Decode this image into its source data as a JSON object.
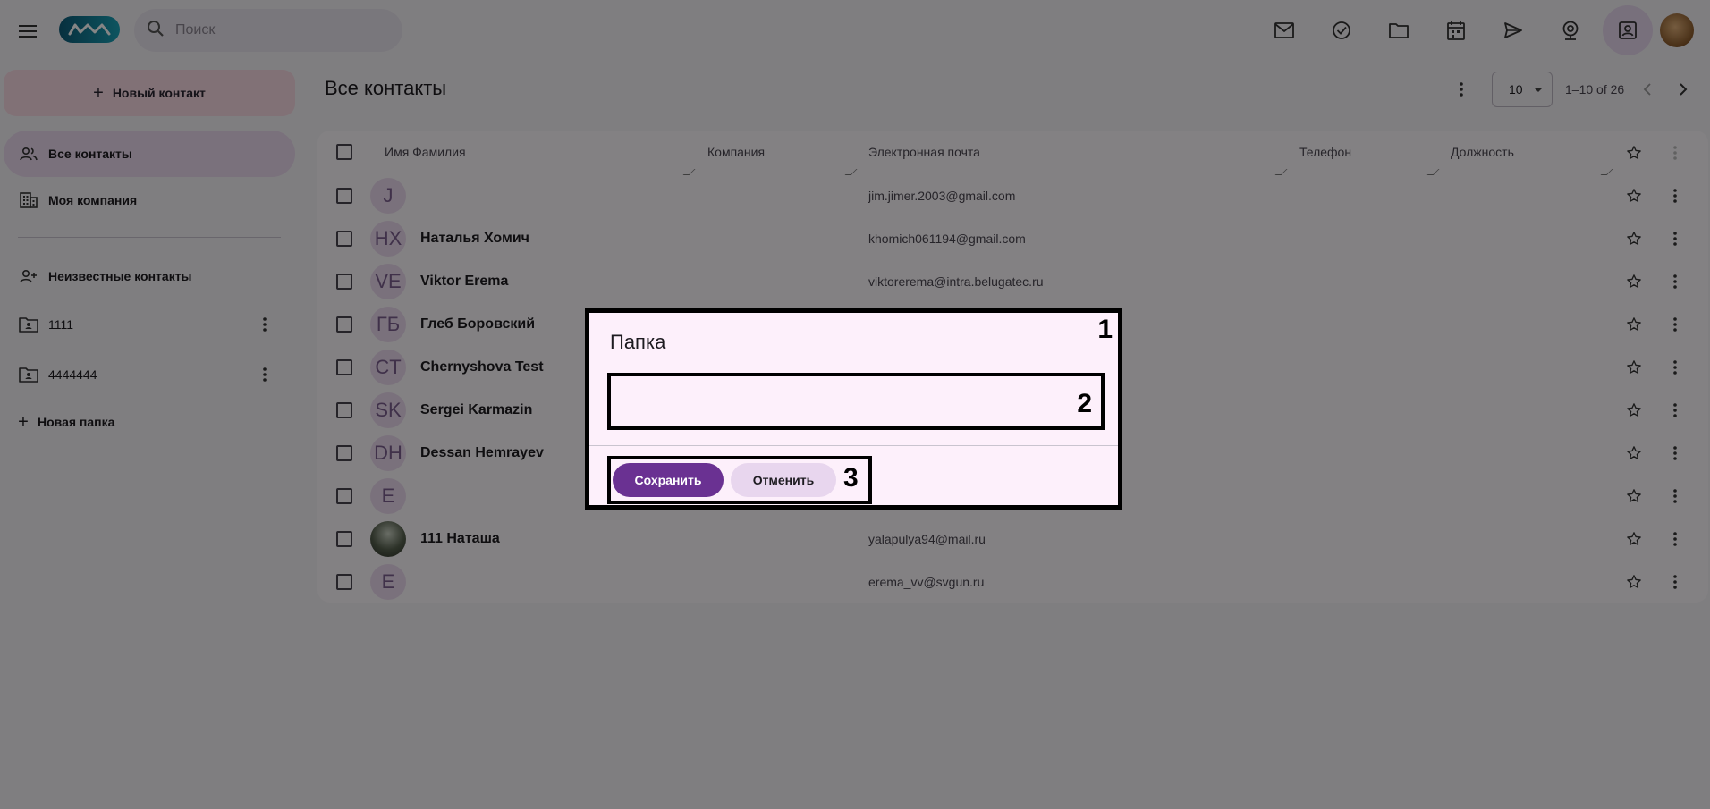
{
  "header": {
    "search_placeholder": "Поиск",
    "top_icons": [
      "mail-icon",
      "task-check-icon",
      "folder-icon",
      "calendar-icon",
      "send-icon",
      "webcam-icon",
      "contacts-icon"
    ],
    "active_icon": "contacts-icon"
  },
  "sidebar": {
    "new_contact_label": "Новый контакт",
    "items": [
      {
        "label": "Все контакты",
        "active": true
      },
      {
        "label": "Моя компания"
      }
    ],
    "unknown_contacts": "Неизвестные контакты",
    "folders": [
      {
        "label": "1111"
      },
      {
        "label": "4444444"
      }
    ],
    "new_folder_label": "Новая папка"
  },
  "main": {
    "title": "Все контакты",
    "page_size": "10",
    "range": "1–10 of 26",
    "columns": [
      "Имя Фамилия",
      "Компания",
      "Электронная почта",
      "Телефон",
      "Должность"
    ],
    "rows": [
      {
        "initials": "J",
        "name": "",
        "email": "jim.jimer.2003@gmail.com"
      },
      {
        "initials": "НХ",
        "name": "Наталья Хомич",
        "email": "khomich061194@gmail.com"
      },
      {
        "initials": "VE",
        "name": "Viktor Erema",
        "email": "viktorerema@intra.belugatec.ru"
      },
      {
        "initials": "ГБ",
        "name": "Глеб Боровский",
        "email": ""
      },
      {
        "initials": "CT",
        "name": "Chernyshova Test",
        "email": ""
      },
      {
        "initials": "SK",
        "name": "Sergei Karmazin",
        "email": ""
      },
      {
        "initials": "DH",
        "name": "Dessan Hemrayev",
        "email": ""
      },
      {
        "initials": "E",
        "name": "",
        "email": ""
      },
      {
        "initials": "",
        "name": "111 Наташа",
        "email": "yalapulya94@mail.ru",
        "photo": true
      },
      {
        "initials": "E",
        "name": "",
        "email": "erema_vv@svgun.ru"
      }
    ]
  },
  "dialog": {
    "title": "Папка",
    "input_value": "",
    "save_label": "Сохранить",
    "cancel_label": "Отменить",
    "markers": [
      "1",
      "2",
      "3"
    ]
  },
  "colors": {
    "accent": "#6a3192",
    "active_nav": "#ead8ee",
    "new_contact_bg": "#f8d9e3",
    "dialog_bg": "#fdf0fb"
  }
}
